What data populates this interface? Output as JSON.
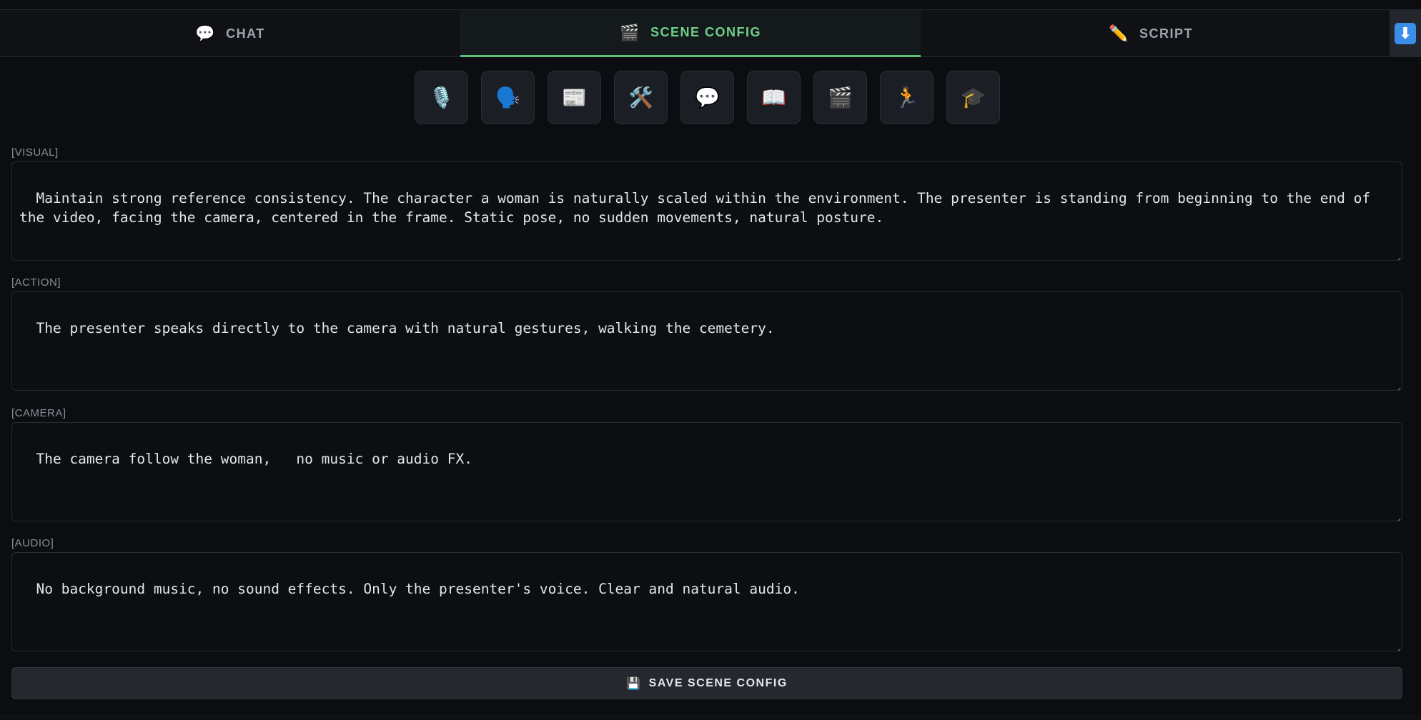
{
  "tabs": [
    {
      "label": "CHAT",
      "icon": "💬",
      "icon_name": "speech-bubble-icon",
      "active": false
    },
    {
      "label": "SCENE CONFIG",
      "icon": "🎬",
      "icon_name": "clapper-board-icon",
      "active": true
    },
    {
      "label": "SCRIPT",
      "icon": "✏️",
      "icon_name": "pencil-icon",
      "active": false
    }
  ],
  "download_button": {
    "icon": "⬇",
    "icon_name": "download-icon"
  },
  "presets": [
    {
      "icon": "🎙️",
      "icon_name": "microphone-icon"
    },
    {
      "icon": "🗣️",
      "icon_name": "speaking-head-icon"
    },
    {
      "icon": "📰",
      "icon_name": "newspaper-icon"
    },
    {
      "icon": "🛠️",
      "icon_name": "tools-icon"
    },
    {
      "icon": "💬",
      "icon_name": "speech-bubble-icon"
    },
    {
      "icon": "📖",
      "icon_name": "open-book-icon"
    },
    {
      "icon": "🎬",
      "icon_name": "clapper-board-icon"
    },
    {
      "icon": "🏃",
      "icon_name": "runner-icon"
    },
    {
      "icon": "🎓",
      "icon_name": "graduation-cap-icon"
    }
  ],
  "fields": {
    "visual": {
      "label": "[VISUAL]",
      "value": "Maintain strong reference consistency. The character a woman is naturally scaled within the environment. The presenter is standing from beginning to the end of the video, facing the camera, centered in the frame. Static pose, no sudden movements, natural posture."
    },
    "action": {
      "label": "[ACTION]",
      "value": "The presenter speaks directly to the camera with natural gestures, walking the cemetery."
    },
    "camera": {
      "label": "[CAMERA]",
      "value": "The camera follow the woman,   no music or audio FX."
    },
    "audio": {
      "label": "[AUDIO]",
      "value": "No background music, no sound effects. Only the presenter's voice. Clear and natural audio."
    }
  },
  "save_button": {
    "label": "SAVE SCENE CONFIG",
    "icon": "💾",
    "icon_name": "floppy-disk-icon"
  },
  "colors": {
    "background": "#0b0d11",
    "active_tab_text": "#6fd08a",
    "active_tab_underline": "#58c07a",
    "download_accent": "#3a8ee8"
  }
}
